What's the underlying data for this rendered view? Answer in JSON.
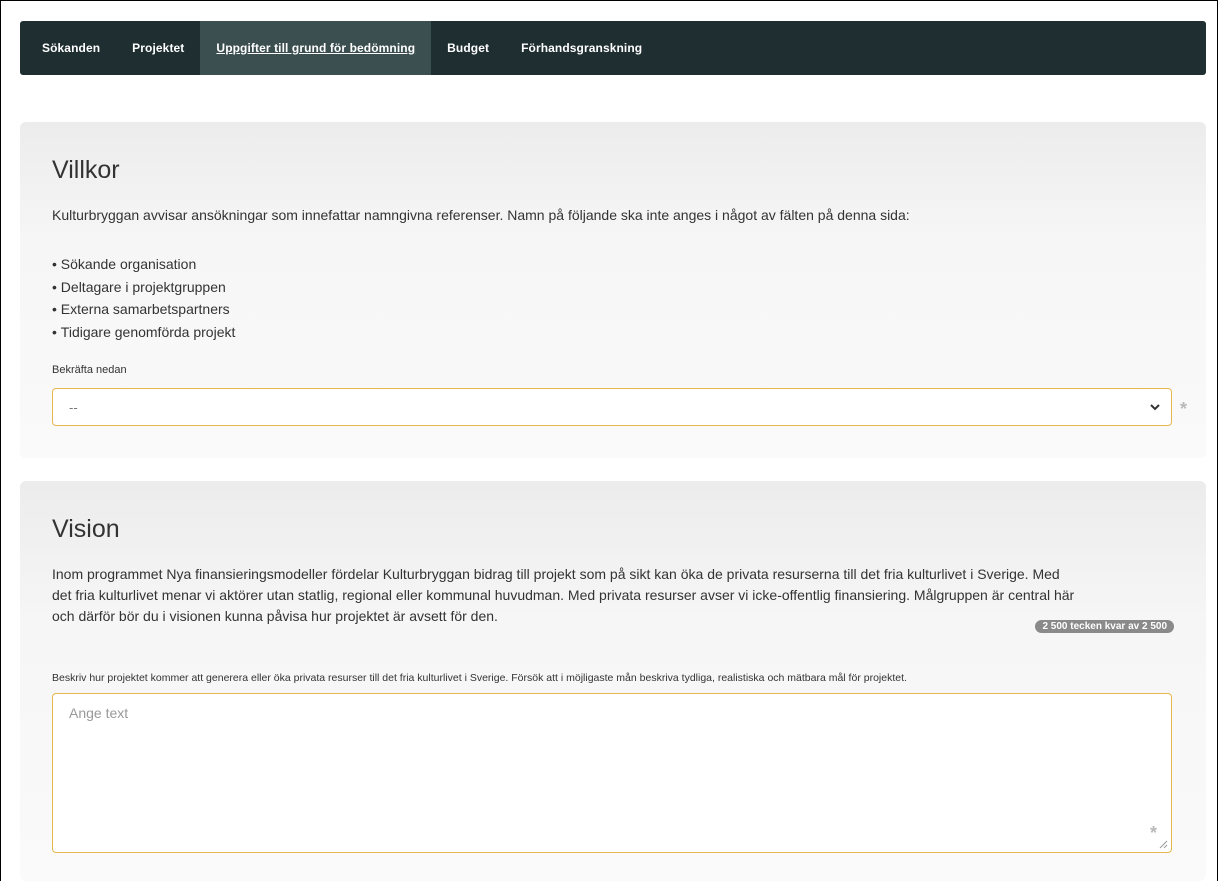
{
  "nav": {
    "items": [
      {
        "label": "Sökanden",
        "active": false
      },
      {
        "label": "Projektet",
        "active": false
      },
      {
        "label": "Uppgifter till grund för bedömning",
        "active": true
      },
      {
        "label": "Budget",
        "active": false
      },
      {
        "label": "Förhandsgranskning",
        "active": false
      }
    ]
  },
  "villkor": {
    "title": "Villkor",
    "intro": "Kulturbryggan avvisar ansökningar som innefattar namngivna referenser. Namn på följande ska inte anges i något av fälten på denna sida:",
    "list": [
      "Sökande organisation",
      "Deltagare i projektgruppen",
      "Externa samarbetspartners",
      "Tidigare genomförda projekt"
    ],
    "confirm_label": "Bekräfta nedan",
    "select_value": "--",
    "required_mark": "*"
  },
  "vision": {
    "title": "Vision",
    "paragraph_lines": [
      "Inom programmet Nya finansieringsmodeller fördelar Kulturbryggan bidrag till projekt som på sikt kan öka de privata resurserna till det fria kulturlivet i Sverige. Med",
      "det fria kulturlivet menar vi aktörer utan statlig, regional eller kommunal huvudman. Med privata resurser avser vi icke-offentlig finansiering. Målgruppen är central här",
      "och därför bör du i visionen kunna påvisa hur projektet är avsett för den."
    ],
    "counter": "2 500 tecken kvar av 2 500",
    "field_label": "Beskriv hur projektet kommer att generera eller öka privata resurser till det fria kulturlivet i Sverige. Försök att i möjligaste mån beskriva tydliga, realistiska och mätbara mål för projektet.",
    "placeholder": "Ange text",
    "required_mark": "*"
  },
  "colors": {
    "navbar": "#1f2e30",
    "nav_active": "#3b4e50",
    "field_border": "#e8b84e",
    "counter_badge": "#8a8a8a"
  }
}
